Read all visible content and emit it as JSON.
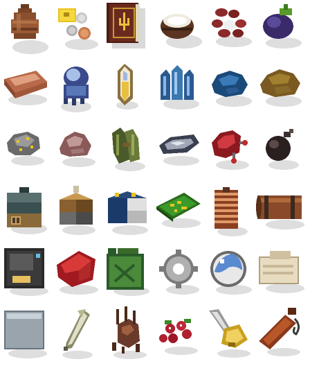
{
  "sheet": {
    "background": "#ffffff",
    "rows": 6,
    "columns": 6,
    "style": "pixel-art icons with soft gray drop shadows"
  },
  "items": [
    {
      "name": "clay-pot-icon",
      "color": "#8a4f2e"
    },
    {
      "name": "coins-and-gold-note-icon",
      "color": "#e8c420"
    },
    {
      "name": "leather-book-icon",
      "color": "#6b2a1e"
    },
    {
      "name": "coconut-icon",
      "color": "#5a3420"
    },
    {
      "name": "red-beans-icon",
      "color": "#8a2a2a"
    },
    {
      "name": "eggplant-icon",
      "color": "#3a2a6a"
    },
    {
      "name": "copper-ingot-icon",
      "color": "#c67a5a"
    },
    {
      "name": "ghost-spirit-icon",
      "color": "#5a78b8"
    },
    {
      "name": "crystal-shard-icon",
      "color": "#c8b070"
    },
    {
      "name": "blue-crystals-icon",
      "color": "#3a78b0"
    },
    {
      "name": "blue-ore-chunk-icon",
      "color": "#1a4a7a"
    },
    {
      "name": "brown-ore-chunk-icon",
      "color": "#8a6a2a"
    },
    {
      "name": "gold-speck-rock-icon",
      "color": "#8a8a8a"
    },
    {
      "name": "pink-rock-icon",
      "color": "#b88880"
    },
    {
      "name": "green-fibers-icon",
      "color": "#6a7a3a"
    },
    {
      "name": "iron-scrap-icon",
      "color": "#5a6070"
    },
    {
      "name": "red-machine-part-icon",
      "color": "#b02a30"
    },
    {
      "name": "black-bomb-icon",
      "color": "#2a2020"
    },
    {
      "name": "barrel-sack-icon",
      "color": "#3a5050"
    },
    {
      "name": "lantern-device-icon",
      "color": "#8a6030"
    },
    {
      "name": "car-battery-icon",
      "color": "#1a3a6a"
    },
    {
      "name": "circuit-board-icon",
      "color": "#3a9a2a"
    },
    {
      "name": "copper-coil-icon",
      "color": "#c8703a"
    },
    {
      "name": "wooden-barrel-icon",
      "color": "#8a4a2a"
    },
    {
      "name": "metal-box-icon",
      "color": "#3a3a3a"
    },
    {
      "name": "red-cloth-icon",
      "color": "#c02a2a"
    },
    {
      "name": "jerry-can-icon",
      "color": "#4a8a3a"
    },
    {
      "name": "gear-icon",
      "color": "#9a9a9a"
    },
    {
      "name": "glass-orb-icon",
      "color": "#5a8ad0"
    },
    {
      "name": "paper-scroll-icon",
      "color": "#e0d0b0"
    },
    {
      "name": "steel-plate-icon",
      "color": "#9aa4ac"
    },
    {
      "name": "feather-quill-icon",
      "color": "#c8c8a0"
    },
    {
      "name": "gnarled-root-icon",
      "color": "#6a3a2a"
    },
    {
      "name": "red-berries-icon",
      "color": "#b02030"
    },
    {
      "name": "gold-drill-icon",
      "color": "#c8a020"
    },
    {
      "name": "brown-pouch-icon",
      "color": "#8a3a1a"
    }
  ]
}
